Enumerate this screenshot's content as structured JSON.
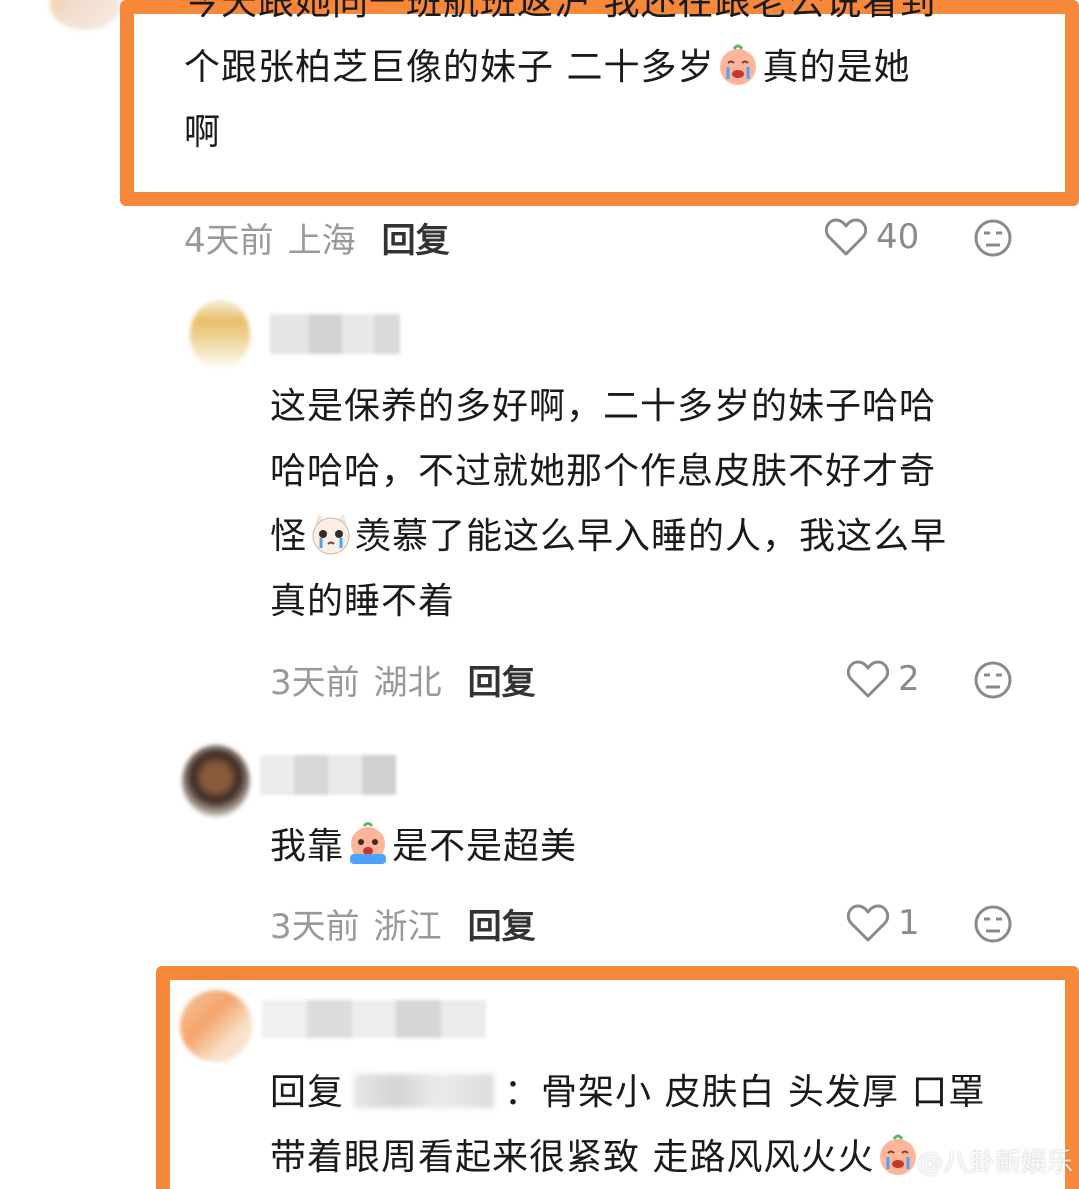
{
  "comments": [
    {
      "lines": [
        "今天跟她同一班航班返沪 我还在跟老公说看到",
        "个跟张柏芝巨像的妹子 二十多岁",
        "真的是她",
        "啊"
      ],
      "time": "4天前",
      "location": "上海",
      "reply_label": "回复",
      "likes": "40"
    },
    {
      "lines": [
        "这是保养的多好啊，二十多岁的妹子哈哈",
        "哈哈哈，不过就她那个作息皮肤不好才奇",
        "怪",
        "羡慕了能这么早入睡的人，我这么早",
        "真的睡不着"
      ],
      "time": "3天前",
      "location": "湖北",
      "reply_label": "回复",
      "likes": "2"
    },
    {
      "lines": [
        "我靠",
        "是不是超美"
      ],
      "time": "3天前",
      "location": "浙江",
      "reply_label": "回复",
      "likes": "1"
    },
    {
      "lines": [
        "回复",
        "：骨架小 皮肤白 头发厚 口罩",
        "带着眼周看起来很紧致 走路风风火火"
      ]
    }
  ],
  "watermark": "@八卦新娱乐",
  "colors": {
    "highlight": "#f7883a",
    "meta": "#999999",
    "text": "#1a1a1a"
  },
  "icons": [
    "heart-icon",
    "meh-face-icon",
    "cry-emoji",
    "cat-cry-emoji"
  ]
}
